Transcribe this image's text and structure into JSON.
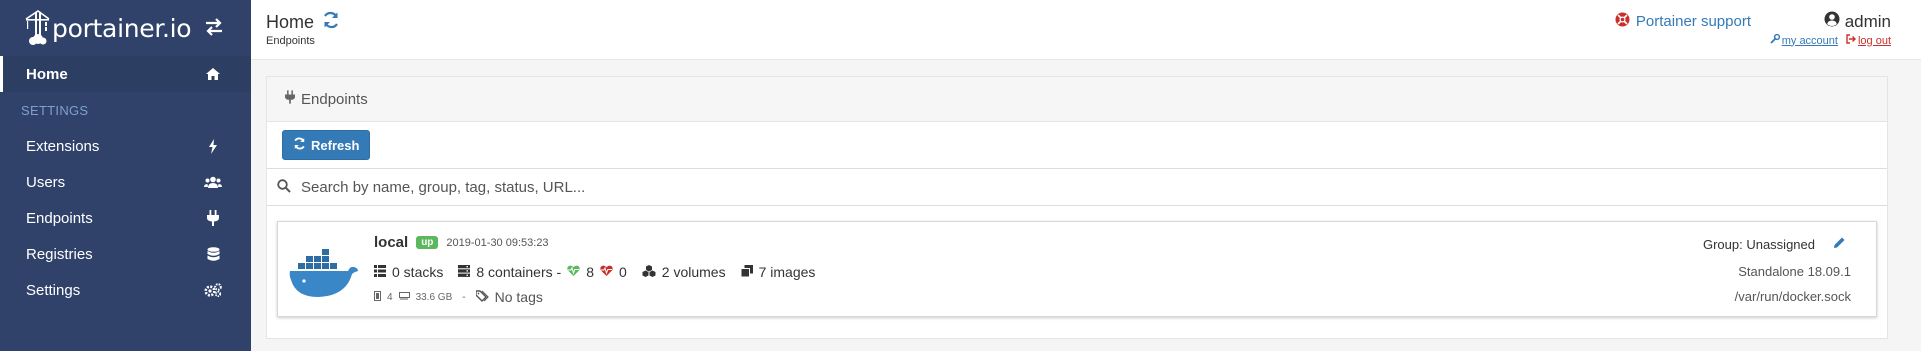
{
  "brand": {
    "name": "portainer.io"
  },
  "sidebar": {
    "items": [
      {
        "label": "Home",
        "icon": "home-icon",
        "active": true
      },
      {
        "label": "SETTINGS",
        "type": "heading"
      },
      {
        "label": "Extensions",
        "icon": "bolt-icon"
      },
      {
        "label": "Users",
        "icon": "users-icon"
      },
      {
        "label": "Endpoints",
        "icon": "plug-icon"
      },
      {
        "label": "Registries",
        "icon": "database-icon"
      },
      {
        "label": "Settings",
        "icon": "cogs-icon"
      }
    ]
  },
  "header": {
    "title": "Home",
    "breadcrumb": "Endpoints",
    "support_label": "Portainer support",
    "username": "admin",
    "my_account": "my account",
    "log_out": "log out"
  },
  "panel": {
    "title": "Endpoints",
    "refresh_label": "Refresh",
    "search_placeholder": "Search by name, group, tag, status, URL..."
  },
  "endpoint": {
    "name": "local",
    "status": "up",
    "date": "2019-01-30 09:53:23",
    "stacks": "0 stacks",
    "containers": "8 containers -",
    "healthy": "8",
    "unhealthy": "0",
    "volumes": "2 volumes",
    "images": "7 images",
    "cpu": "4",
    "memory": "33.6 GB",
    "separator": "-",
    "tags": "No tags",
    "group": "Group: Unassigned",
    "version": "Standalone 18.09.1",
    "url": "/var/run/docker.sock"
  },
  "colors": {
    "sidebar": "#30426a",
    "primary": "#337ab7",
    "success": "#5cb85c",
    "danger": "#c9302c",
    "heading": "#7fa0cf"
  }
}
